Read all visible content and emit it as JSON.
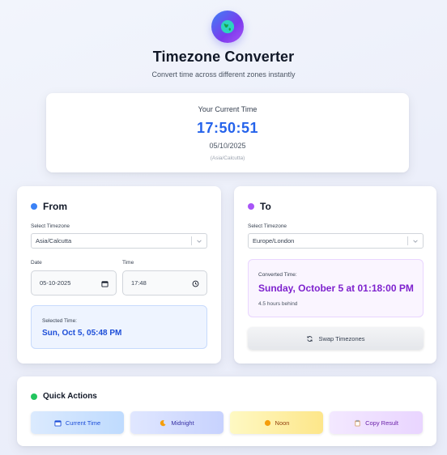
{
  "header": {
    "title": "Timezone Converter",
    "subtitle": "Convert time across different zones instantly",
    "icon": "globe-icon"
  },
  "current": {
    "label": "Your Current Time",
    "time": "17:50:51",
    "date": "05/10/2025",
    "timezone": "(Asia/Calcutta)"
  },
  "from": {
    "heading": "From",
    "timezone_label": "Select Timezone",
    "timezone_value": "Asia/Calcutta",
    "date_label": "Date",
    "date_value": "05-10-2025",
    "time_label": "Time",
    "time_value": "17:48",
    "selected_label": "Selected Time:",
    "selected_value": "Sun, Oct 5, 05:48 PM"
  },
  "to": {
    "heading": "To",
    "timezone_label": "Select Timezone",
    "timezone_value": "Europe/London",
    "converted_label": "Converted Time:",
    "converted_value": "Sunday, October 5 at 01:18:00 PM",
    "difference": "4.5 hours behind",
    "swap_label": "Swap Timezones"
  },
  "quick_actions": {
    "heading": "Quick Actions",
    "current_time": "Current Time",
    "midnight": "Midnight",
    "noon": "Noon",
    "copy_result": "Copy Result"
  },
  "colors": {
    "accent_blue": "#2563eb",
    "accent_purple": "#7e22ce",
    "from_dot": "#3b82f6",
    "to_dot": "#a855f7",
    "actions_dot": "#22c55e"
  }
}
